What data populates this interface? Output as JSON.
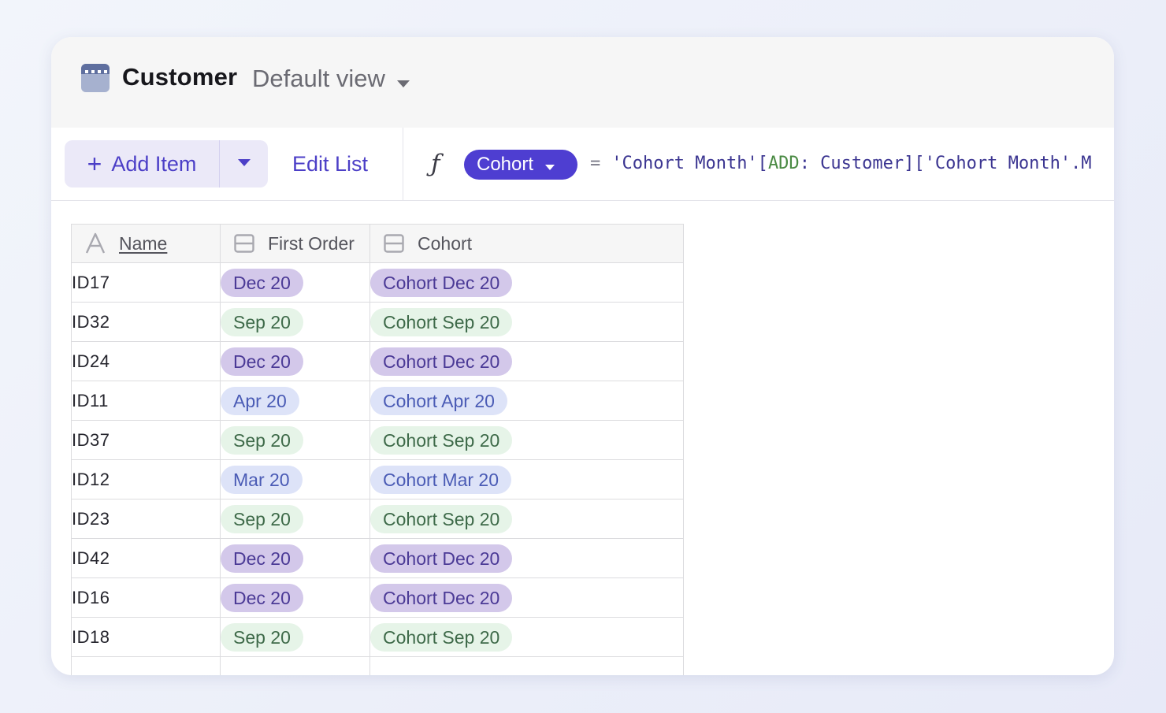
{
  "header": {
    "title": "Customer",
    "view": "Default view"
  },
  "toolbar": {
    "add_label": "Add Item",
    "edit_label": "Edit List"
  },
  "formula": {
    "column": "Cohort",
    "equals": "=",
    "part1": "'Cohort Month'[",
    "part2": "ADD",
    "part3": ": Customer]['Cohort Month'.M"
  },
  "table": {
    "columns": [
      "Name",
      "First Order",
      "Cohort"
    ],
    "rows": [
      {
        "name": "ID17",
        "first": "Dec 20",
        "cohort": "Cohort Dec 20",
        "tone": "dec"
      },
      {
        "name": "ID32",
        "first": "Sep 20",
        "cohort": "Cohort Sep 20",
        "tone": "sep"
      },
      {
        "name": "ID24",
        "first": "Dec 20",
        "cohort": "Cohort Dec 20",
        "tone": "dec"
      },
      {
        "name": "ID11",
        "first": "Apr 20",
        "cohort": "Cohort Apr 20",
        "tone": "apr"
      },
      {
        "name": "ID37",
        "first": "Sep 20",
        "cohort": "Cohort Sep 20",
        "tone": "sep"
      },
      {
        "name": "ID12",
        "first": "Mar 20",
        "cohort": "Cohort Mar 20",
        "tone": "mar"
      },
      {
        "name": "ID23",
        "first": "Sep 20",
        "cohort": "Cohort Sep 20",
        "tone": "sep"
      },
      {
        "name": "ID42",
        "first": "Dec 20",
        "cohort": "Cohort Dec 20",
        "tone": "dec"
      },
      {
        "name": "ID16",
        "first": "Dec 20",
        "cohort": "Cohort Dec 20",
        "tone": "dec"
      },
      {
        "name": "ID18",
        "first": "Sep 20",
        "cohort": "Cohort Sep 20",
        "tone": "sep"
      }
    ]
  },
  "tones": {
    "dec": {
      "bg": "#d3c8ea",
      "fg": "#4b3a96"
    },
    "sep": {
      "bg": "#e6f4e8",
      "fg": "#3e6a49"
    },
    "apr": {
      "bg": "#dde3f8",
      "fg": "#4a5bb5"
    },
    "mar": {
      "bg": "#dde3f8",
      "fg": "#4a5bb5"
    }
  },
  "colors": {
    "accent": "#4e3ed1",
    "accent_text": "#4c3fc7"
  },
  "icons": {
    "database": "database-icon",
    "caret": "caret-down-icon",
    "plus": "plus-icon",
    "formula": "function-icon",
    "text_column": "text-column-icon",
    "choice_column": "choice-column-icon"
  }
}
